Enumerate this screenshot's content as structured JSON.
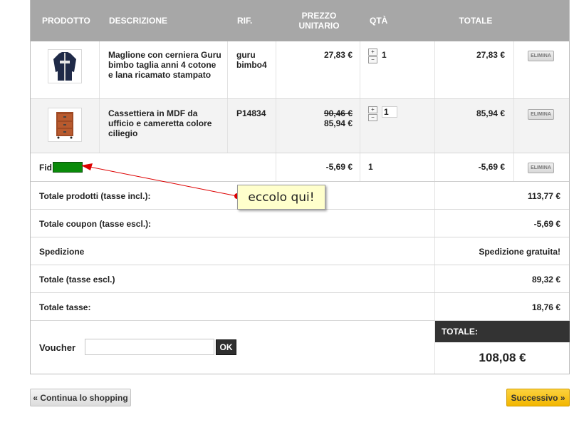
{
  "table": {
    "headers": {
      "prodotto": "PRODOTTO",
      "descrizione": "DESCRIZIONE",
      "rif": "RIF.",
      "prezzo_line1": "PREZZO",
      "prezzo_line2": "UNITARIO",
      "qta": "QTÀ",
      "totale": "TOTALE"
    },
    "rows": [
      {
        "descrizione": "Maglione con cerniera Guru bimbo taglia anni 4 cotone e lana ricamato stampato",
        "rif": "guru bimbo4",
        "prezzo_old": "",
        "prezzo": "27,83 €",
        "qta": "1",
        "totale": "27,83 €",
        "delete_label": "ELIMINA",
        "qty_plus": "+",
        "qty_minus": "−"
      },
      {
        "descrizione": "Cassettiera in MDF da ufficio e cameretta colore ciliegio",
        "rif": "P14834",
        "prezzo_old": "90,46 €",
        "prezzo": "85,94 €",
        "qta": "1",
        "totale": "85,94 €",
        "delete_label": "ELIMINA",
        "qty_plus": "+",
        "qty_minus": "−"
      }
    ],
    "discount_row": {
      "label": "Fid",
      "prezzo": "-5,69 €",
      "qta": "1",
      "totale": "-5,69 €",
      "delete_label": "ELIMINA",
      "highlight_color": "#0a8a0a"
    }
  },
  "summary": [
    {
      "label": "Totale prodotti (tasse incl.):",
      "value": "113,77 €"
    },
    {
      "label": "Totale coupon (tasse escl.):",
      "value": "-5,69 €"
    },
    {
      "label": "Spedizione",
      "value": "Spedizione gratuita!"
    },
    {
      "label": "Totale (tasse escl.)",
      "value": "89,32 €"
    },
    {
      "label": "Totale tasse:",
      "value": "18,76 €"
    }
  ],
  "voucher": {
    "label": "Voucher",
    "input_value": "",
    "ok_label": "OK"
  },
  "total": {
    "label": "TOTALE:",
    "value": "108,08 €"
  },
  "buttons": {
    "continue": "« Continua lo shopping",
    "next": "Successivo »"
  },
  "annotation": {
    "callout_text": "eccolo qui!",
    "arrow_color": "#dd0000"
  },
  "colors": {
    "header_bg": "#a7a7a7",
    "total_header_bg": "#333333",
    "next_button": "#f2b600"
  }
}
